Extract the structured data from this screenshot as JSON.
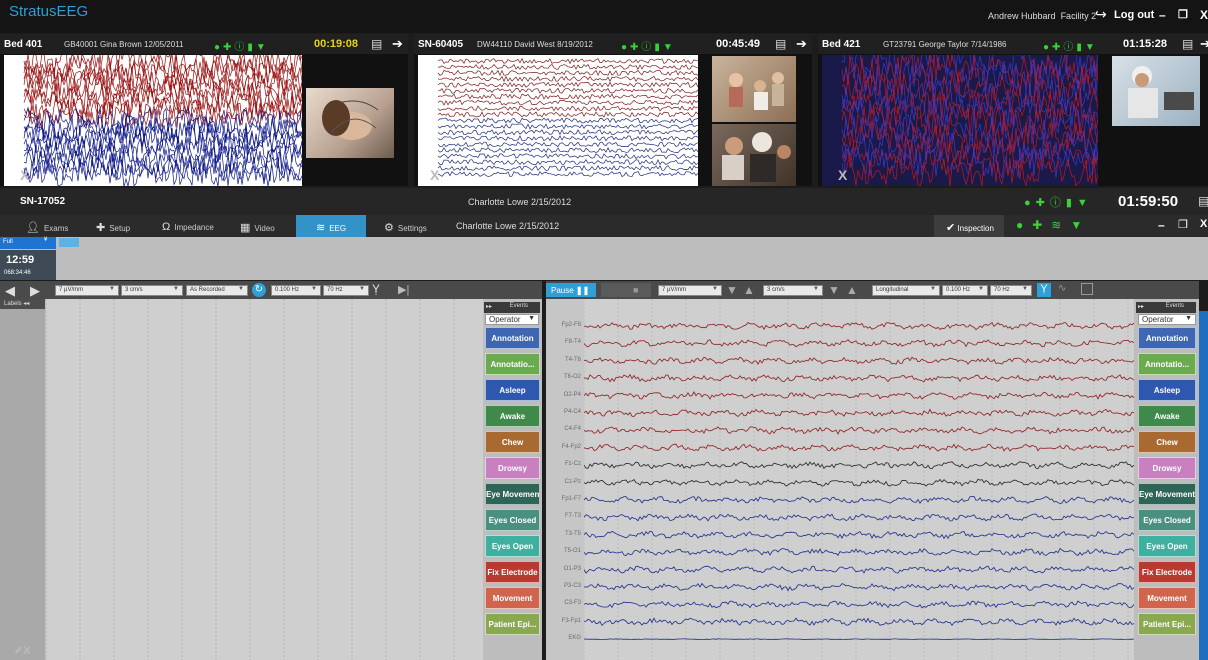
{
  "app": {
    "title": "StratusEEG",
    "user": "Andrew Hubbard",
    "facility": "Facility 2",
    "logout": "Log out"
  },
  "tiles": [
    {
      "bed": "Bed 401",
      "info": "GB40001 Gina Brown 12/05/2011",
      "timer": "00:19:08",
      "timer_color": "#e8d218",
      "eeg_style": "dense-red-blue"
    },
    {
      "sn": "SN-60405",
      "info": "DW44110 David West 8/19/2012",
      "timer": "00:45:49",
      "timer_color": "#ffffff",
      "eeg_style": "sparse"
    },
    {
      "bed": "Bed 421",
      "info": "GT23791 George Taylor 7/14/1986",
      "timer": "01:15:28",
      "timer_color": "#ffffff",
      "eeg_style": "dense-purple"
    }
  ],
  "session": {
    "sn": "SN-17052",
    "patient": "Charlotte Lowe 2/15/2012",
    "timer": "01:59:50"
  },
  "tabs": [
    {
      "label": "Exams",
      "icon": "person-icon"
    },
    {
      "label": "Setup",
      "icon": "electrode-icon"
    },
    {
      "label": "Impedance",
      "icon": "omega-icon"
    },
    {
      "label": "Video",
      "icon": "video-icon"
    },
    {
      "label": "EEG",
      "icon": "eeg-wave-icon",
      "active": true
    },
    {
      "label": "Settings",
      "icon": "gear-icon"
    }
  ],
  "tabbar_patient": "Charlotte Lowe 2/15/2012",
  "inspection": "Inspection",
  "view": {
    "mode": "Full",
    "clock": "12:59",
    "date": "068:34:46"
  },
  "left_controls": {
    "sensitivity": "7 µV/mm",
    "speed": "3 cm/s",
    "montage": "As Recorded",
    "lowcut": "0.100 Hz",
    "highcut": "70 Hz",
    "labels": "Labels"
  },
  "right_controls": {
    "pause": "Pause",
    "sensitivity": "7 µV/mm",
    "speed": "3 cm/s",
    "montage": "Longitudinal",
    "lowcut": "0.100 Hz",
    "highcut": "70 Hz"
  },
  "events": {
    "header": "Events",
    "operator": "Operator",
    "buttons": [
      {
        "label": "Annotation",
        "color": "#3f66b0"
      },
      {
        "label": "Annotatio...",
        "color": "#6bab4f"
      },
      {
        "label": "Asleep",
        "color": "#2e57b0"
      },
      {
        "label": "Awake",
        "color": "#3f8a4a"
      },
      {
        "label": "Chew",
        "color": "#a86a30"
      },
      {
        "label": "Drowsy",
        "color": "#c880c0"
      },
      {
        "label": "Eye Movement",
        "color": "#2f6458"
      },
      {
        "label": "Eyes Closed",
        "color": "#4a9080"
      },
      {
        "label": "Eyes Open",
        "color": "#3fb0a0"
      },
      {
        "label": "Fix Electrode",
        "color": "#b83a30"
      },
      {
        "label": "Movement",
        "color": "#d0644c"
      },
      {
        "label": "Patient Epi...",
        "color": "#8aa850"
      }
    ]
  },
  "channels": [
    {
      "name": "Fp2-F8",
      "color": "#8b1a1a"
    },
    {
      "name": "F8-T4",
      "color": "#8b1a1a"
    },
    {
      "name": "T4-T6",
      "color": "#8b1a1a"
    },
    {
      "name": "T6-O2",
      "color": "#8b1a1a"
    },
    {
      "name": "O2-P4",
      "color": "#8b1a1a"
    },
    {
      "name": "P4-C4",
      "color": "#8b1a1a"
    },
    {
      "name": "C4-F4",
      "color": "#8b1a1a"
    },
    {
      "name": "F4-Fp2",
      "color": "#8b1a1a"
    },
    {
      "name": "Fz-Cz",
      "color": "#222222"
    },
    {
      "name": "Cz-Pz",
      "color": "#222222"
    },
    {
      "name": "Fp1-F7",
      "color": "#1a2a8b"
    },
    {
      "name": "F7-T3",
      "color": "#1a2a8b"
    },
    {
      "name": "T3-T5",
      "color": "#1a2a8b"
    },
    {
      "name": "T5-O1",
      "color": "#1a2a8b"
    },
    {
      "name": "O1-P3",
      "color": "#1a2a8b"
    },
    {
      "name": "P3-C3",
      "color": "#1a2a8b"
    },
    {
      "name": "C3-F3",
      "color": "#1a2a8b"
    },
    {
      "name": "F3-Fp1",
      "color": "#1a2a8b"
    },
    {
      "name": "EKG",
      "color": "#1a2a8b"
    }
  ]
}
